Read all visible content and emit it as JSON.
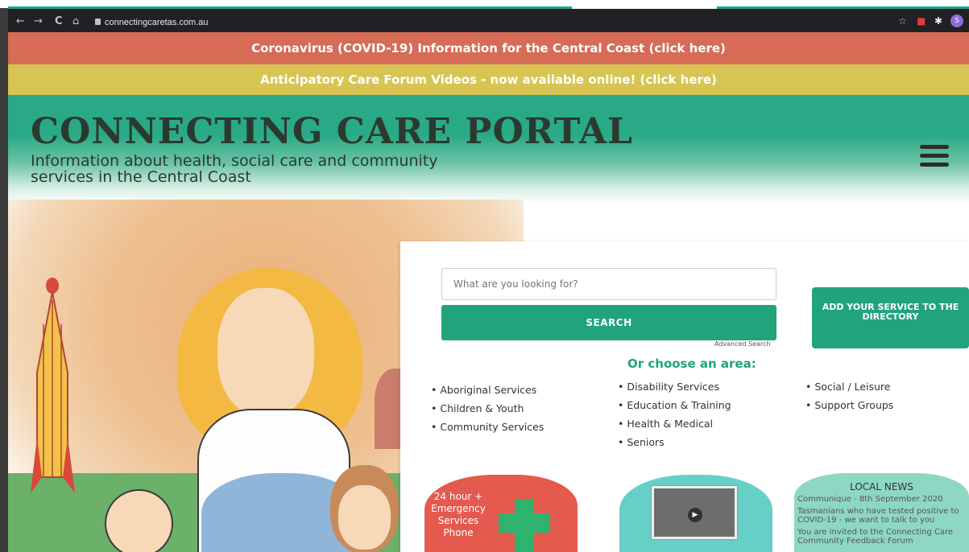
{
  "browser": {
    "url": "connectingcaretas.com.au",
    "nav": {
      "back": "←",
      "forward": "→",
      "reload": "C",
      "home": "⌂"
    },
    "extensions": [
      "☆",
      "■",
      "✱",
      "S"
    ]
  },
  "banners": {
    "covid": "Coronavirus (COVID-19) Information for the Central Coast (click here)",
    "forum": "Anticipatory Care Forum Videos - now available online! (click here)"
  },
  "brand": {
    "title": "CONNECTING CARE PORTAL",
    "subtitle": "Information about health, social care and community services in the Central Coast"
  },
  "search": {
    "placeholder": "What are you looking for?",
    "button_label": "SEARCH",
    "advanced_label": "Advanced Search"
  },
  "add_service": {
    "label": "ADD YOUR SERVICE TO THE DIRECTORY"
  },
  "areas": {
    "heading": "Or choose an area:",
    "column1": [
      "Aboriginal Services",
      "Children & Youth",
      "Community Services"
    ],
    "column2": [
      "Disability Services",
      "Education & Training",
      "Health & Medical",
      "Seniors"
    ],
    "column3": [
      "Social / Leisure",
      "Support Groups"
    ]
  },
  "emergency_card": {
    "text": "24 hour + Emergency Services Phone"
  },
  "local_news": {
    "title": "LOCAL NEWS",
    "items": [
      "Communique - 8th September 2020",
      "Tasmanians who have tested positive to COVID-19 - we want to talk to you",
      "You are invited to the Connecting Care Community Feedback Forum"
    ]
  },
  "colors": {
    "brand_green": "#21a37c",
    "covid_banner": "#d66b56",
    "forum_banner": "#d8c452"
  }
}
